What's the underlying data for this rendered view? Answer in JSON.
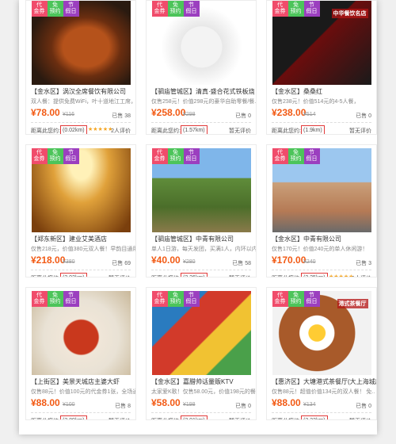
{
  "colors": {
    "price": "#f25a14",
    "badge_dai": "#f04c6b",
    "badge_mian": "#4cc45a",
    "badge_jie": "#9b3fbf",
    "distance_border": "#e23a3a"
  },
  "badges": [
    {
      "top": "代",
      "bottom": "金券"
    },
    {
      "top": "免",
      "bottom": "预约"
    },
    {
      "top": "节",
      "bottom": "假日"
    }
  ],
  "labels": {
    "distance_prefix": "距离此您约:"
  },
  "cards": [
    {
      "title": "【金水区】涡汉全席餐饮有限公司",
      "desc": "双人餐：提供免费WiFi，叶十道地江工席，",
      "price": "¥78.00",
      "old": "¥116",
      "sold": "已售 38",
      "distance": "(0.02km)",
      "stars": "★★★★★",
      "rating": "2人评价",
      "photo": "fish",
      "photo_text": ""
    },
    {
      "title": "【驷庙管城区】清真·盛合花式铁板烧",
      "desc": "仅售258元！价值298元的豪华自助零餐/餐...",
      "price": "¥258.00",
      "old": "¥298",
      "sold": "已售 0",
      "distance": "(1.57km)",
      "stars": "",
      "rating": "暂无评价",
      "photo": "shrimp",
      "photo_text": ""
    },
    {
      "title": "【金水区】桑桑红",
      "desc": "仅售238元！价值514元的4-5人餐，",
      "price": "¥238.00",
      "old": "¥514",
      "sold": "已售 0",
      "distance": "(1.9km)",
      "stars": "",
      "rating": "暂无评价",
      "photo": "hotpot",
      "photo_text": "中华餐饮名店"
    },
    {
      "title": "【郑东新区】建业艾美酒店",
      "desc": "仅售218元，价值380元双人餐！早韵目通用",
      "price": "¥218.00",
      "old": "¥380",
      "sold": "已售 69",
      "distance": "(2.03km)",
      "stars": "",
      "rating": "暂无评价",
      "photo": "hall",
      "photo_text": ""
    },
    {
      "title": "【驷庙管城区】中青有限公司",
      "desc": "单人1日游，每天发团，买满1人，内环以内...",
      "price": "¥40.00",
      "old": "¥280",
      "sold": "已售 58",
      "distance": "(2.26km)",
      "stars": "",
      "rating": "暂无评价",
      "photo": "wall",
      "photo_text": ""
    },
    {
      "title": "【金水区】中青有限公司",
      "desc": "仅售170元！价值240元的单人休闲游！",
      "price": "¥170.00",
      "old": "¥240",
      "sold": "已售 3",
      "distance": "(2.25km)",
      "stars": "★★★★★",
      "rating": "1人评价",
      "photo": "castle",
      "photo_text": ""
    },
    {
      "title": "【上街区】美景天城店主婆大虾",
      "desc": "仅售88元！价值100元的代金券1张，全场通...",
      "price": "¥88.00",
      "old": "¥100",
      "sold": "已售 8",
      "distance": "(2.89km)",
      "stars": "",
      "rating": "暂无评价",
      "photo": "crayfish",
      "photo_text": ""
    },
    {
      "title": "【金水区】嘉腊帅话量贩KTV",
      "desc": "太家爱K歌！仅售58.00元，价值198元的餐...",
      "price": "¥58.00",
      "old": "¥198",
      "sold": "已售 0",
      "distance": "(3.01km)",
      "stars": "",
      "rating": "暂无评价",
      "photo": "fruit",
      "photo_text": ""
    },
    {
      "title": "【惠济区】大塘港式茶餐厅(大上海城店",
      "desc": "仅售88元！超值价值134元的双人餐！ 免..",
      "price": "¥88.00",
      "old": "¥134",
      "sold": "已售 0",
      "distance": "(3.23km)",
      "stars": "",
      "rating": "暂无评价",
      "photo": "egg",
      "photo_text": "港式茶餐厅"
    }
  ]
}
